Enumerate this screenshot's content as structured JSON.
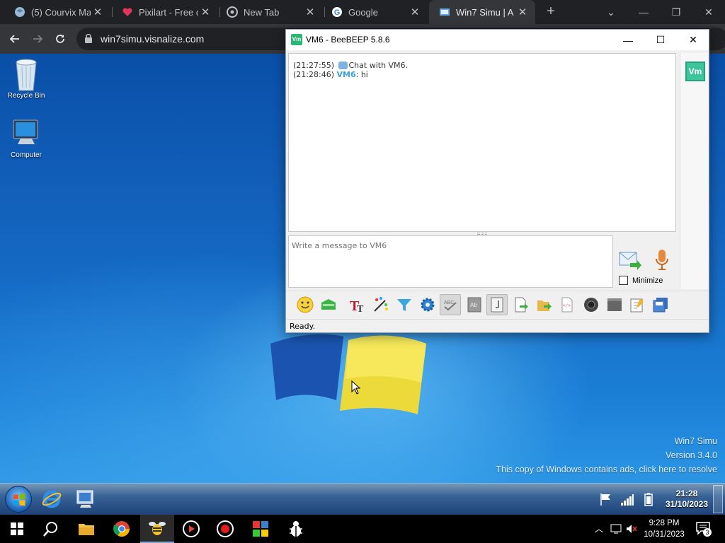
{
  "browser": {
    "tabs": [
      {
        "title": "(5) Courvix Ma",
        "icon": "courvix-favicon",
        "active": false
      },
      {
        "title": "Pixilart - Free o",
        "icon": "heart-favicon",
        "active": false
      },
      {
        "title": "New Tab",
        "icon": "chrome-favicon",
        "active": false
      },
      {
        "title": "Google",
        "icon": "google-favicon",
        "active": false
      },
      {
        "title": "Win7 Simu | A ",
        "icon": "win7simu-favicon",
        "active": true
      }
    ],
    "new_tab_label": "+",
    "url": "win7simu.visnalize.com",
    "window_controls": {
      "dropdown": "⌄",
      "minimize": "—",
      "restore": "❐",
      "close": "✕"
    }
  },
  "desktop": {
    "icons": [
      {
        "label": "Recycle Bin",
        "icon": "recycle-bin-icon"
      },
      {
        "label": "Computer",
        "icon": "computer-icon"
      }
    ],
    "watermark": {
      "line1": "Win7 Simu",
      "line2": "Version 3.4.0",
      "line3": "This copy of Windows contains ads, click here to resolve"
    }
  },
  "beebeep": {
    "title": "VM6 - BeeBEEP 5.8.6",
    "app_icon_text": "Vm",
    "controls": {
      "minimize": "—",
      "maximize": "☐",
      "close": "✕"
    },
    "chat": [
      {
        "time": "(21:27:55)",
        "nick": "",
        "text": "Chat with VM6.",
        "system": true
      },
      {
        "time": "(21:28:46)",
        "nick": "VM6",
        "text": ": hi",
        "system": false
      }
    ],
    "input_placeholder": "Write a message to VM6",
    "minimize_label": "Minimize",
    "minimize_checked": false,
    "user_avatar": "Vm",
    "toolbar_icons": [
      "emoticon-icon",
      "inbox-icon",
      "font-icon",
      "color-picker-icon",
      "filter-icon",
      "settings-gear-icon",
      "spellcheck-icon",
      "dictionary-icon",
      "word-completion-icon",
      "send-file-icon",
      "send-folder-icon",
      "html-icon",
      "screenshot-icon",
      "clear-icon",
      "save-icon",
      "save-as-icon"
    ],
    "pressed_toolbar": [
      6,
      8
    ],
    "status": "Ready."
  },
  "win7_taskbar": {
    "pinned": [
      "internet-explorer-icon",
      "beebeep-app-icon"
    ],
    "clock_time": "21:28",
    "clock_date": "31/10/2023"
  },
  "host_taskbar": {
    "pinned": [
      "file-explorer-icon",
      "chrome-icon",
      "beebeep-icon",
      "media-player-icon",
      "record-icon",
      "paint-icon",
      "bug-icon"
    ],
    "active_index": 2,
    "clock_time": "9:28 PM",
    "clock_date": "10/31/2023",
    "notification_count": "3"
  }
}
